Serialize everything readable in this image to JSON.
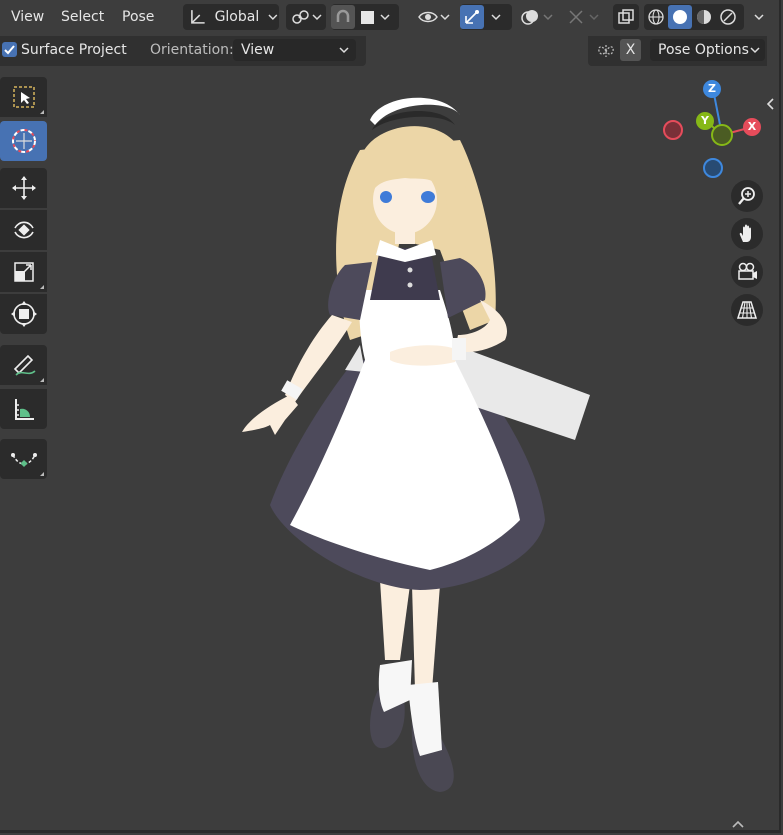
{
  "menu": {
    "view": "View",
    "select": "Select",
    "pose": "Pose"
  },
  "header": {
    "transform_orientation": "Global"
  },
  "options": {
    "surface_project_label": "Surface Project",
    "surface_project_checked": true,
    "orientation_label": "Orientation:",
    "orientation_value": "View",
    "x_mirror_label": "X",
    "pose_options_label": "Pose Options"
  },
  "gizmo": {
    "z": "Z",
    "y": "Y",
    "x": "X"
  },
  "colors": {
    "accent": "#4772b3",
    "axis_x": "#e64c5b",
    "axis_y": "#86b817",
    "axis_z": "#3e88de"
  },
  "toolbar": {
    "tools": [
      {
        "name": "select-box",
        "icon": "select-box-icon"
      },
      {
        "name": "cursor",
        "icon": "cursor-icon",
        "active": true
      },
      {
        "name": "move",
        "icon": "move-icon"
      },
      {
        "name": "rotate",
        "icon": "rotate-icon"
      },
      {
        "name": "scale",
        "icon": "scale-icon"
      },
      {
        "name": "transform",
        "icon": "transform-icon"
      },
      {
        "name": "annotate",
        "icon": "annotate-icon"
      },
      {
        "name": "measure",
        "icon": "measure-icon"
      },
      {
        "name": "relax",
        "icon": "relax-icon"
      }
    ]
  },
  "nav": [
    "zoom-icon",
    "hand-pan-icon",
    "camera-icon",
    "grid-perspective-icon"
  ]
}
